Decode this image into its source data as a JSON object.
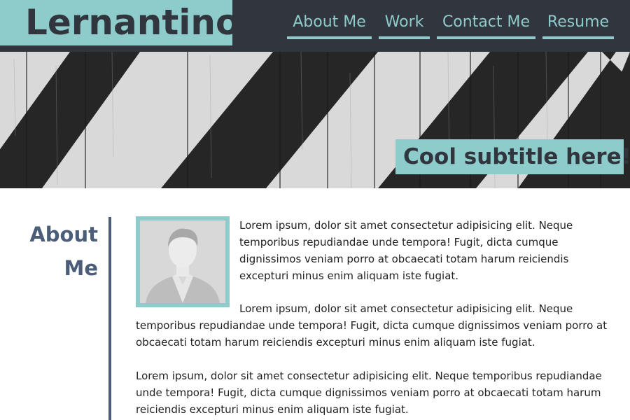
{
  "header": {
    "logo": "Lernantino",
    "nav": [
      {
        "label": "About Me"
      },
      {
        "label": "Work"
      },
      {
        "label": "Contact Me"
      },
      {
        "label": "Resume"
      }
    ]
  },
  "hero": {
    "subtitle": "Cool subtitle here!"
  },
  "about": {
    "heading": "About Me",
    "avatar_icon": "person-silhouette-icon",
    "paragraphs": [
      "Lorem ipsum, dolor sit amet consectetur adipisicing elit. Neque temporibus repudiandae unde tempora! Fugit, dicta cumque dignissimos veniam porro at obcaecati totam harum reiciendis excepturi minus enim aliquam iste fugiat.",
      "Lorem ipsum, dolor sit amet consectetur adipisicing elit. Neque temporibus repudiandae unde tempora! Fugit, dicta cumque dignissimos veniam porro at obcaecati totam harum reiciendis excepturi minus enim aliquam iste fugiat.",
      "Lorem ipsum, dolor sit amet consectetur adipisicing elit. Neque temporibus repudiandae unde tempora! Fugit, dicta cumque dignissimos veniam porro at obcaecati totam harum reiciendis excepturi minus enim aliquam iste fugiat."
    ]
  },
  "colors": {
    "header_bg": "#31353e",
    "accent": "#8ecbcb",
    "heading": "#4b5d78"
  }
}
